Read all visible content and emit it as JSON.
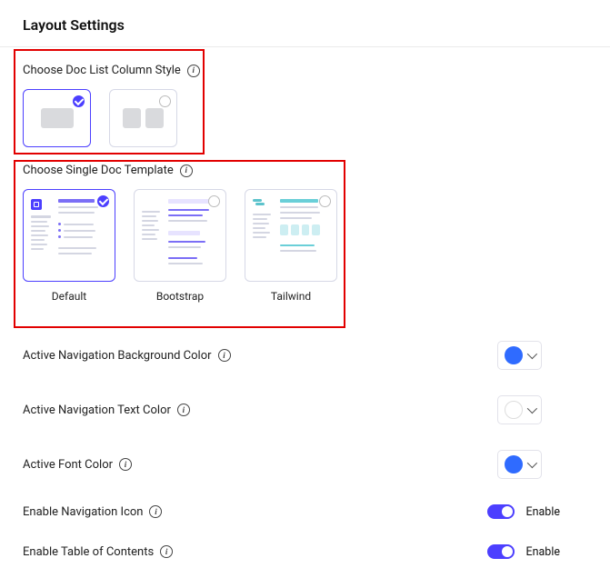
{
  "pageTitle": "Layout Settings",
  "columnStyle": {
    "label": "Choose Doc List Column Style",
    "options": [
      {
        "id": "single",
        "selected": true
      },
      {
        "id": "double",
        "selected": false
      }
    ]
  },
  "singleDocTemplate": {
    "label": "Choose Single Doc Template",
    "options": [
      {
        "id": "default",
        "label": "Default",
        "selected": true
      },
      {
        "id": "bootstrap",
        "label": "Bootstrap",
        "selected": false
      },
      {
        "id": "tailwind",
        "label": "Tailwind",
        "selected": false
      }
    ]
  },
  "settings": {
    "activeNavBg": {
      "label": "Active Navigation Background Color",
      "color": "#2f6bff"
    },
    "activeNavText": {
      "label": "Active Navigation Text Color",
      "color": "#ffffff"
    },
    "activeFont": {
      "label": "Active Font Color",
      "color": "#2f6bff"
    },
    "enableNavIcon": {
      "label": "Enable Navigation Icon",
      "enabled": true,
      "valueText": "Enable"
    },
    "enableToc": {
      "label": "Enable Table of Contents",
      "enabled": true,
      "valueText": "Enable"
    }
  }
}
